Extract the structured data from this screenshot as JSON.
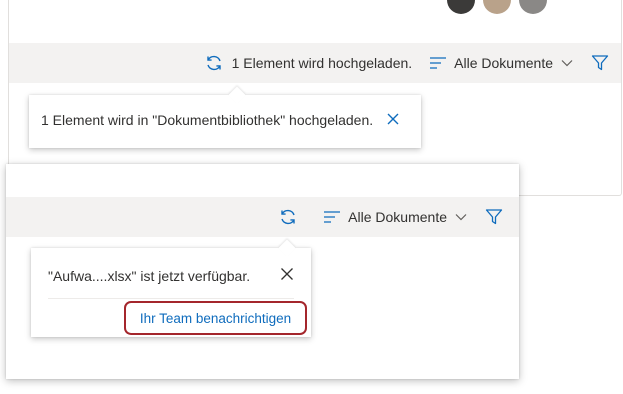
{
  "back_view": {
    "sync_status": "1 Element wird hochgeladen.",
    "view_label": "Alle Dokumente",
    "callout_message": "1 Element wird in \"Dokumentbibliothek\" hochgeladen."
  },
  "front_view": {
    "view_label": "Alle Dokumente",
    "callout_message": "\"Aufwa....xlsx\" ist jetzt verfügbar.",
    "notify_button": "Ihr Team benachrichtigen"
  },
  "colors": {
    "accent": "#0f6cbd",
    "highlight_border": "#a4262c",
    "command_bar_bg": "#f3f2f1"
  },
  "icons": {
    "sync": "sync-icon",
    "view": "view-list-icon",
    "chevron": "chevron-down-icon",
    "filter": "filter-icon",
    "close": "close-icon"
  }
}
